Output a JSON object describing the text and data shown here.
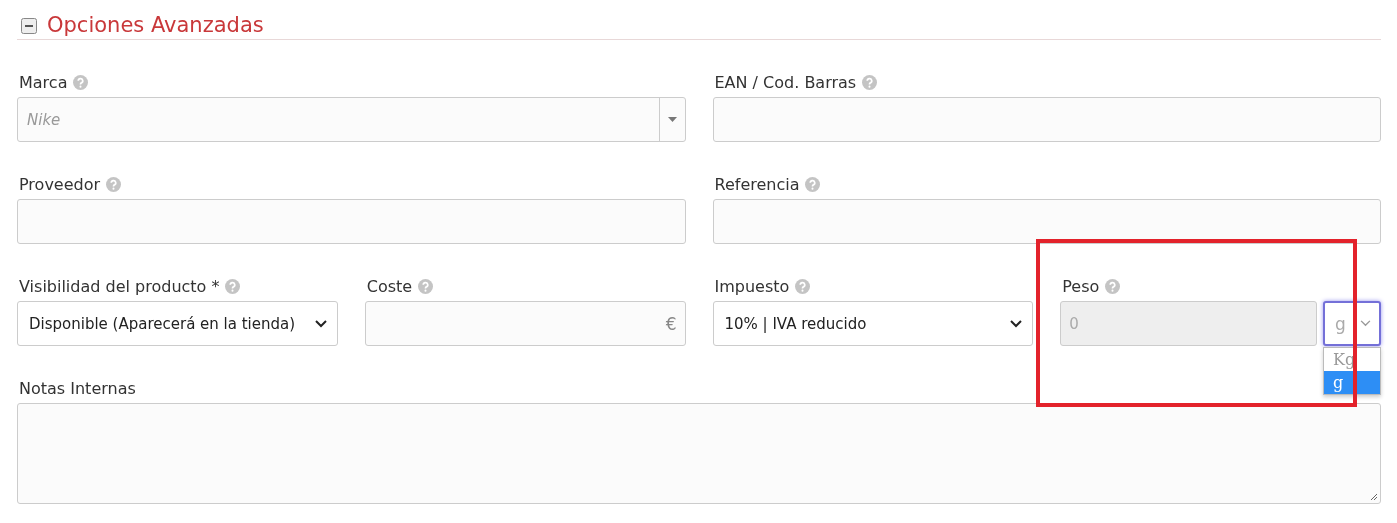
{
  "section": {
    "title": "Opciones Avanzadas",
    "expanded": true
  },
  "rows": [
    [
      {
        "kind": "combo",
        "label": "Marca",
        "help": true,
        "placeholder": "Nike"
      },
      {
        "kind": "text",
        "label": "EAN / Cod. Barras",
        "help": true
      }
    ],
    [
      {
        "kind": "text",
        "label": "Proveedor",
        "help": true
      },
      {
        "kind": "text",
        "label": "Referencia",
        "help": true
      }
    ],
    [
      {
        "kind": "select",
        "label": "Visibilidad del producto *",
        "help": true,
        "value": "Disponible (Aparecerá en la tienda)"
      },
      {
        "kind": "currency",
        "label": "Coste",
        "help": true,
        "suffix": "€"
      },
      {
        "kind": "select",
        "label": "Impuesto",
        "help": true,
        "value": "10% | IVA reducido"
      },
      {
        "kind": "weight",
        "label": "Peso",
        "help": true,
        "value": "0",
        "disabled": true,
        "highlighted": true,
        "unit": {
          "value": "g",
          "focused": true,
          "expanded": true,
          "options": [
            {
              "label": "Kg",
              "selected": false
            },
            {
              "label": "g",
              "selected": true
            }
          ]
        }
      }
    ],
    [
      {
        "kind": "textarea",
        "label": "Notas Internas"
      }
    ]
  ]
}
